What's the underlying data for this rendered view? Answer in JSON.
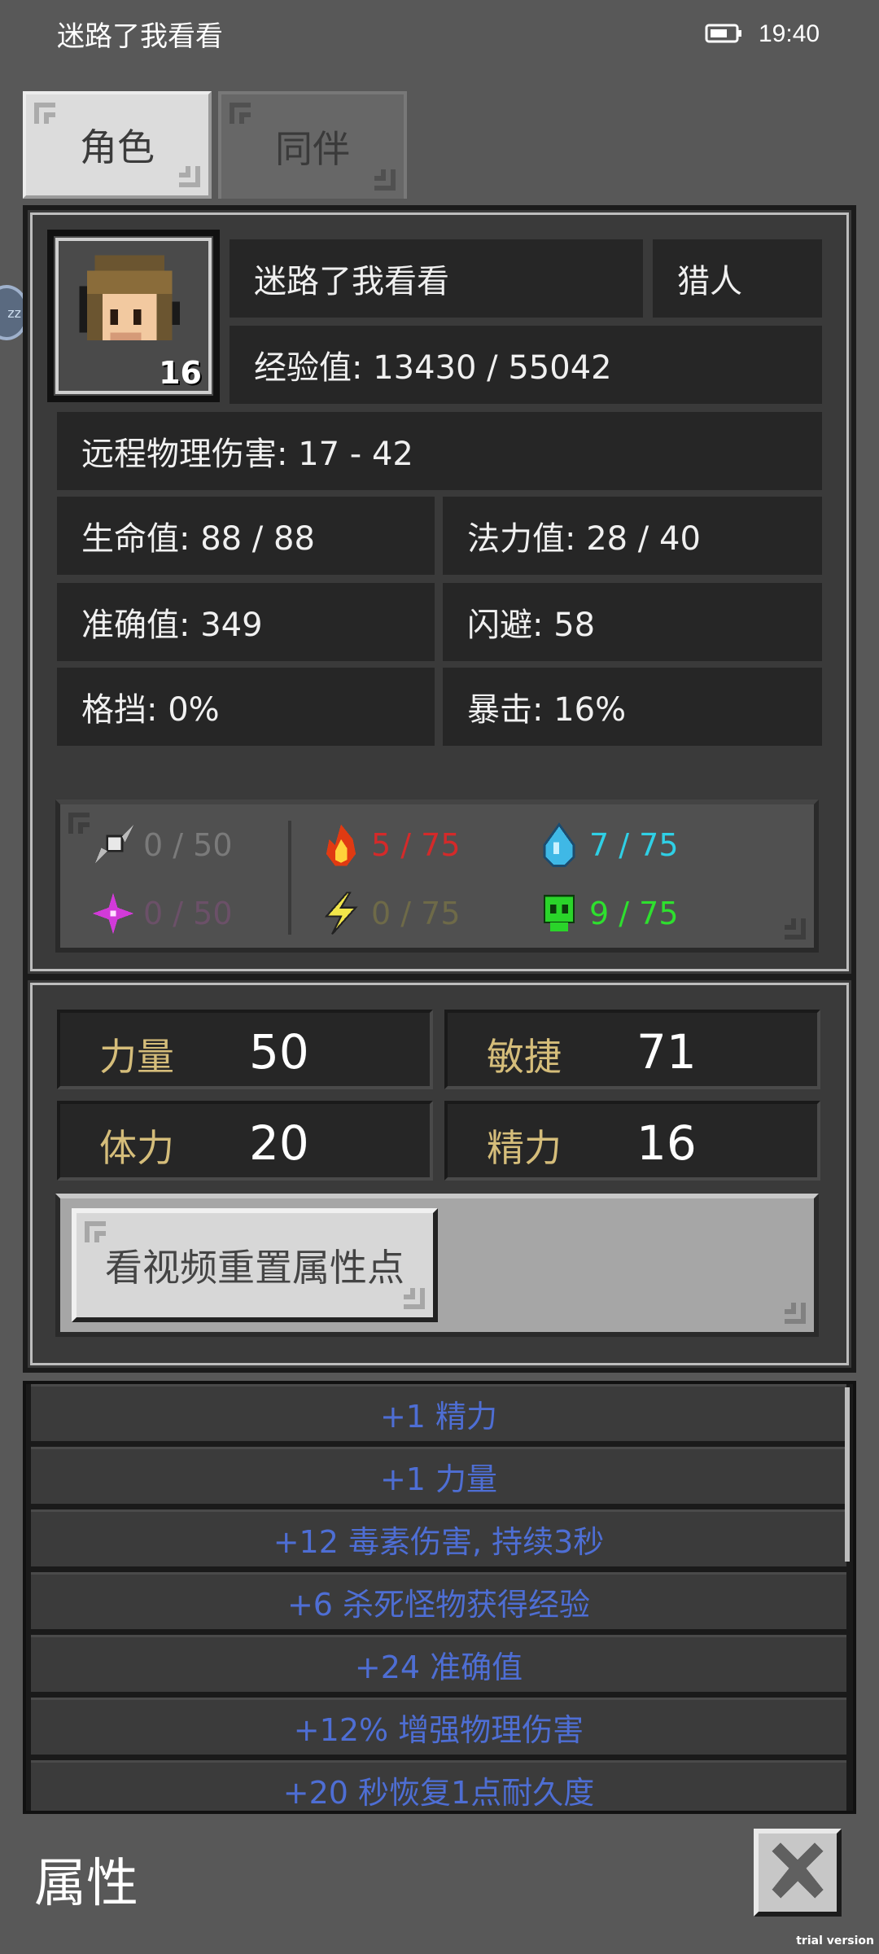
{
  "status_bar": {
    "title": "迷路了我看看",
    "time": "19:40"
  },
  "tabs": [
    {
      "label": "角色",
      "active": true
    },
    {
      "label": "同伴",
      "active": false
    }
  ],
  "character": {
    "name": "迷路了我看看",
    "class": "猎人",
    "level": "16",
    "exp": "经验值: 13430 / 55042",
    "damage": "远程物理伤害: 17 - 42",
    "hp": "生命值: 88 / 88",
    "mp": "法力值: 28 / 40",
    "accuracy": "准确值: 349",
    "dodge": "闪避: 58",
    "block": "格挡: 0%",
    "crit": "暴击: 16%"
  },
  "elements": [
    {
      "icon": "shuriken-icon",
      "value": "0 / 50",
      "color": "#7a7a7a"
    },
    {
      "icon": "fire-icon",
      "value": "5 / 75",
      "color": "#d42a2a"
    },
    {
      "icon": "water-drop-icon",
      "value": "7 / 75",
      "color": "#2fd0e6"
    },
    {
      "icon": "magic-burst-icon",
      "value": "0 / 50",
      "color": "#6b5068"
    },
    {
      "icon": "lightning-icon",
      "value": "0 / 75",
      "color": "#6e6a48"
    },
    {
      "icon": "poison-skull-icon",
      "value": "9 / 75",
      "color": "#2ee02e"
    }
  ],
  "attributes": [
    {
      "label": "力量",
      "value": "50"
    },
    {
      "label": "敏捷",
      "value": "71"
    },
    {
      "label": "体力",
      "value": "20"
    },
    {
      "label": "精力",
      "value": "16"
    }
  ],
  "reset_button": "看视频重置属性点",
  "bonuses": [
    "+1 精力",
    "+1 力量",
    "+12 毒素伤害, 持续3秒",
    "+6 杀死怪物获得经验",
    "+24 准确值",
    "+12% 增强物理伤害",
    "+20 秒恢复1点耐久度"
  ],
  "footer": {
    "title": "属性",
    "trial": "trial version"
  },
  "side_bubble": "zz"
}
